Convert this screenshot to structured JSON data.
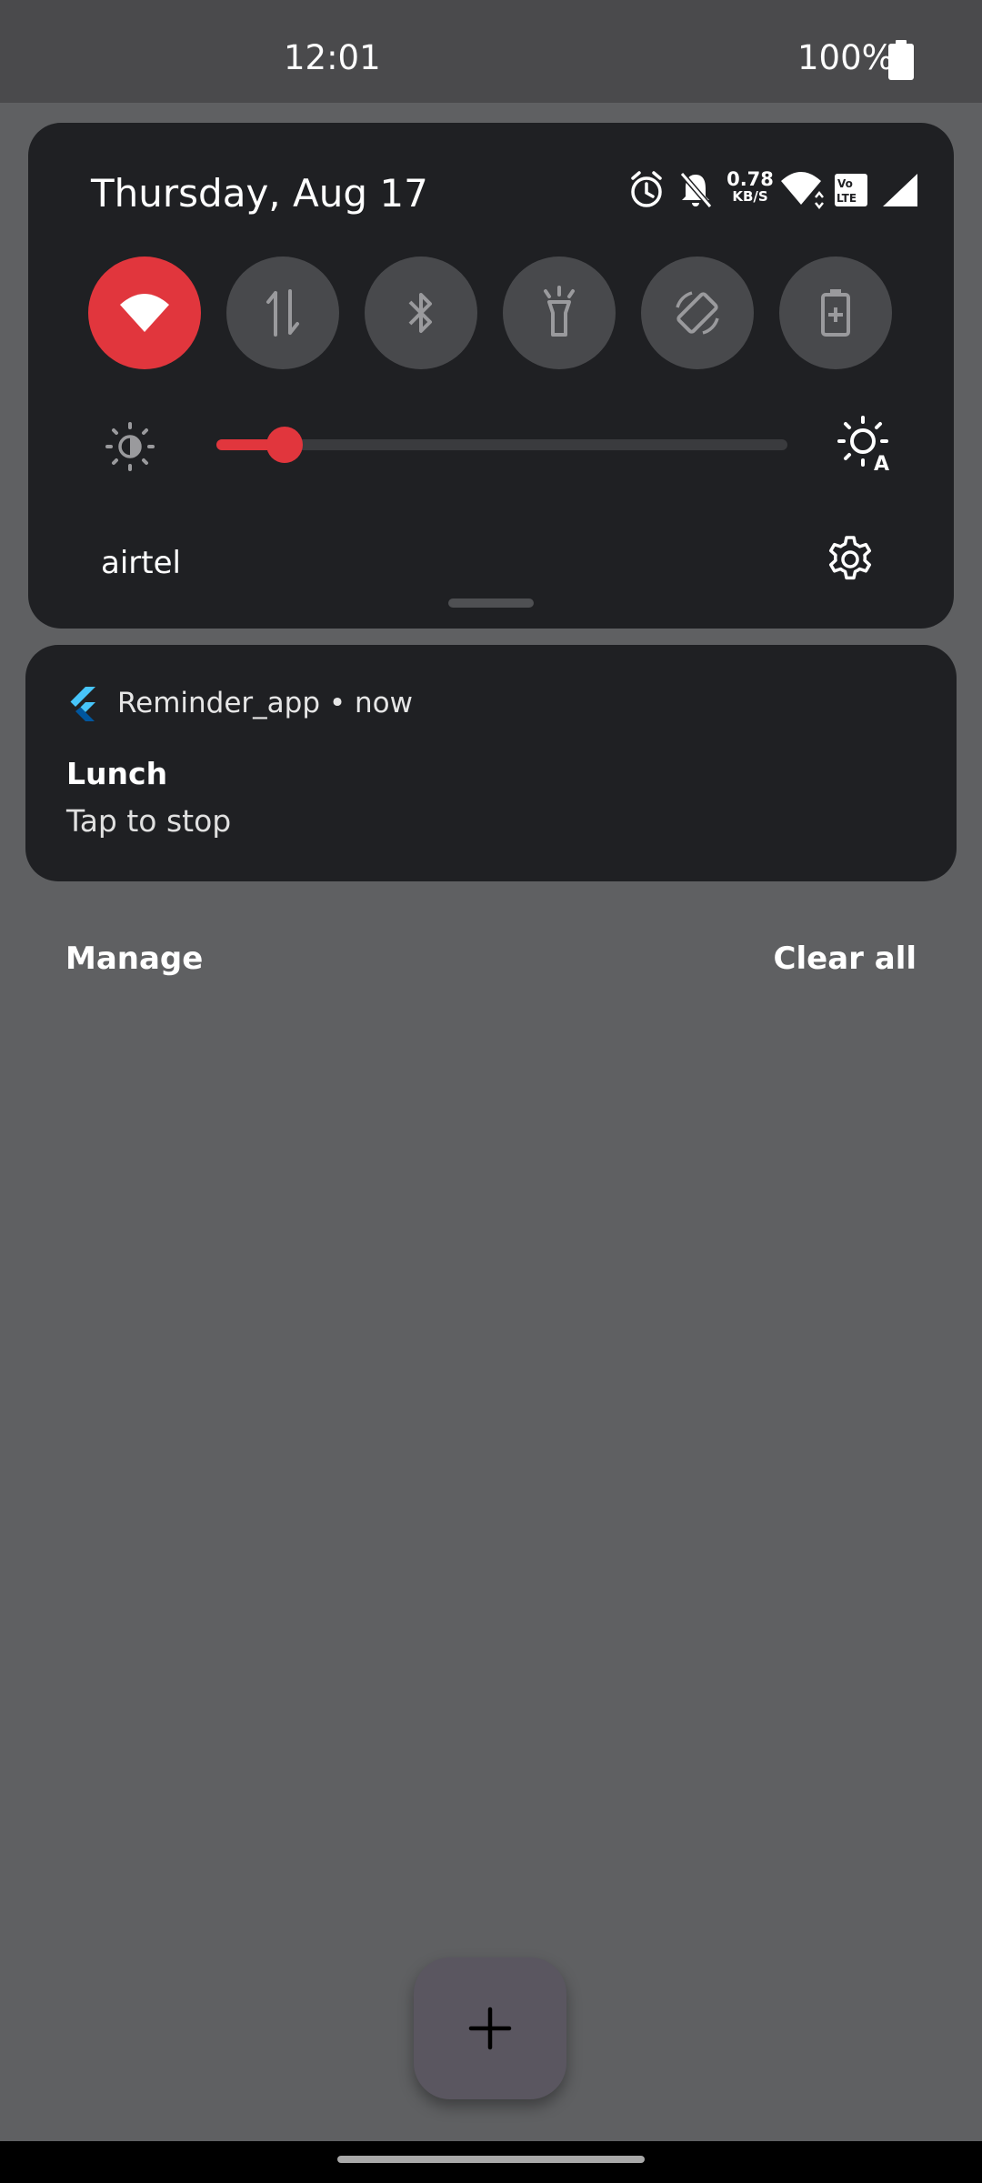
{
  "status_bar": {
    "time": "12:01",
    "battery": "100%"
  },
  "quick_settings": {
    "date": "Thursday, Aug 17",
    "net_speed_value": "0.78",
    "net_speed_unit": "KB/S",
    "tiles": [
      {
        "name": "wifi",
        "active": true
      },
      {
        "name": "mobile-data",
        "active": false
      },
      {
        "name": "bluetooth",
        "active": false
      },
      {
        "name": "flashlight",
        "active": false
      },
      {
        "name": "auto-rotate",
        "active": false
      },
      {
        "name": "battery-saver",
        "active": false
      }
    ],
    "brightness_level": 0.12,
    "carrier": "airtel"
  },
  "notification": {
    "app_name": "Reminder_app",
    "time": "now",
    "title": "Lunch",
    "text": "Tap to stop"
  },
  "actions": {
    "manage": "Manage",
    "clear_all": "Clear all"
  },
  "fab": {
    "icon": "plus-icon"
  },
  "colors": {
    "accent": "#e1363d",
    "panel": "#1f2023",
    "scrim": "#5f6062"
  }
}
